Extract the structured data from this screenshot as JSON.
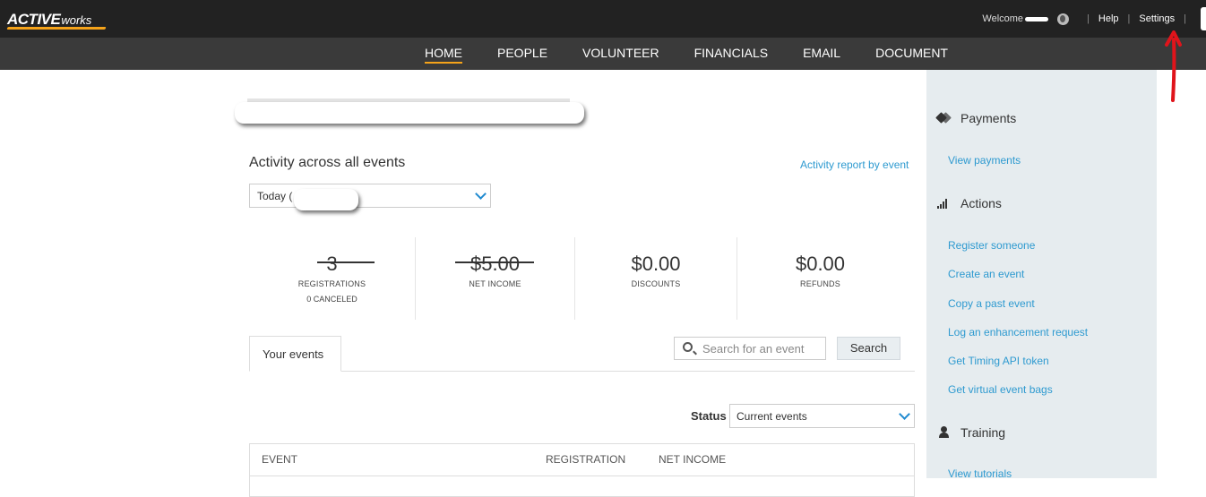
{
  "app": {
    "logo_main": "ACTIVE",
    "logo_sub": "works"
  },
  "topbar": {
    "welcome": "Welcome",
    "help": "Help",
    "settings": "Settings"
  },
  "nav": {
    "items": [
      "HOME",
      "PEOPLE",
      "VOLUNTEER",
      "FINANCIALS",
      "EMAIL",
      "DOCUMENT"
    ],
    "active": "HOME"
  },
  "activity": {
    "title": "Activity across all events",
    "report_link": "Activity report by event",
    "date_range": "Today ("
  },
  "stats": {
    "registrations": {
      "value": "3",
      "label": "REGISTRATIONS",
      "sub": "0 CANCELED"
    },
    "net_income": {
      "value": "$5.00",
      "label": "NET INCOME"
    },
    "discounts": {
      "value": "$0.00",
      "label": "DISCOUNTS"
    },
    "refunds": {
      "value": "$0.00",
      "label": "REFUNDS"
    }
  },
  "events": {
    "tab_label": "Your events",
    "search_placeholder": "Search for an event",
    "search_button": "Search",
    "status_label": "Status",
    "status_value": "Current events",
    "columns": [
      "EVENT",
      "REGISTRATION",
      "NET INCOME"
    ]
  },
  "sidebar": {
    "payments": {
      "title": "Payments",
      "links": [
        "View payments"
      ]
    },
    "actions": {
      "title": "Actions",
      "links": [
        "Register someone",
        "Create an event",
        "Copy a past event",
        "Log an enhancement request",
        "Get Timing API token",
        "Get virtual event bags"
      ]
    },
    "training": {
      "title": "Training",
      "links": [
        "View tutorials"
      ]
    }
  },
  "colors": {
    "topbar": "#222222",
    "navbar": "#3a3a3a",
    "accent": "#f5a31a",
    "link": "#2e9ad0",
    "sidebar_bg": "#e6ecef",
    "annotation_arrow": "#e0141b"
  },
  "icons": [
    "globe-icon",
    "tags-icon",
    "signal-bars-icon",
    "user-icon",
    "search-icon",
    "chevron-down-icon",
    "red-arrow-annotation"
  ]
}
